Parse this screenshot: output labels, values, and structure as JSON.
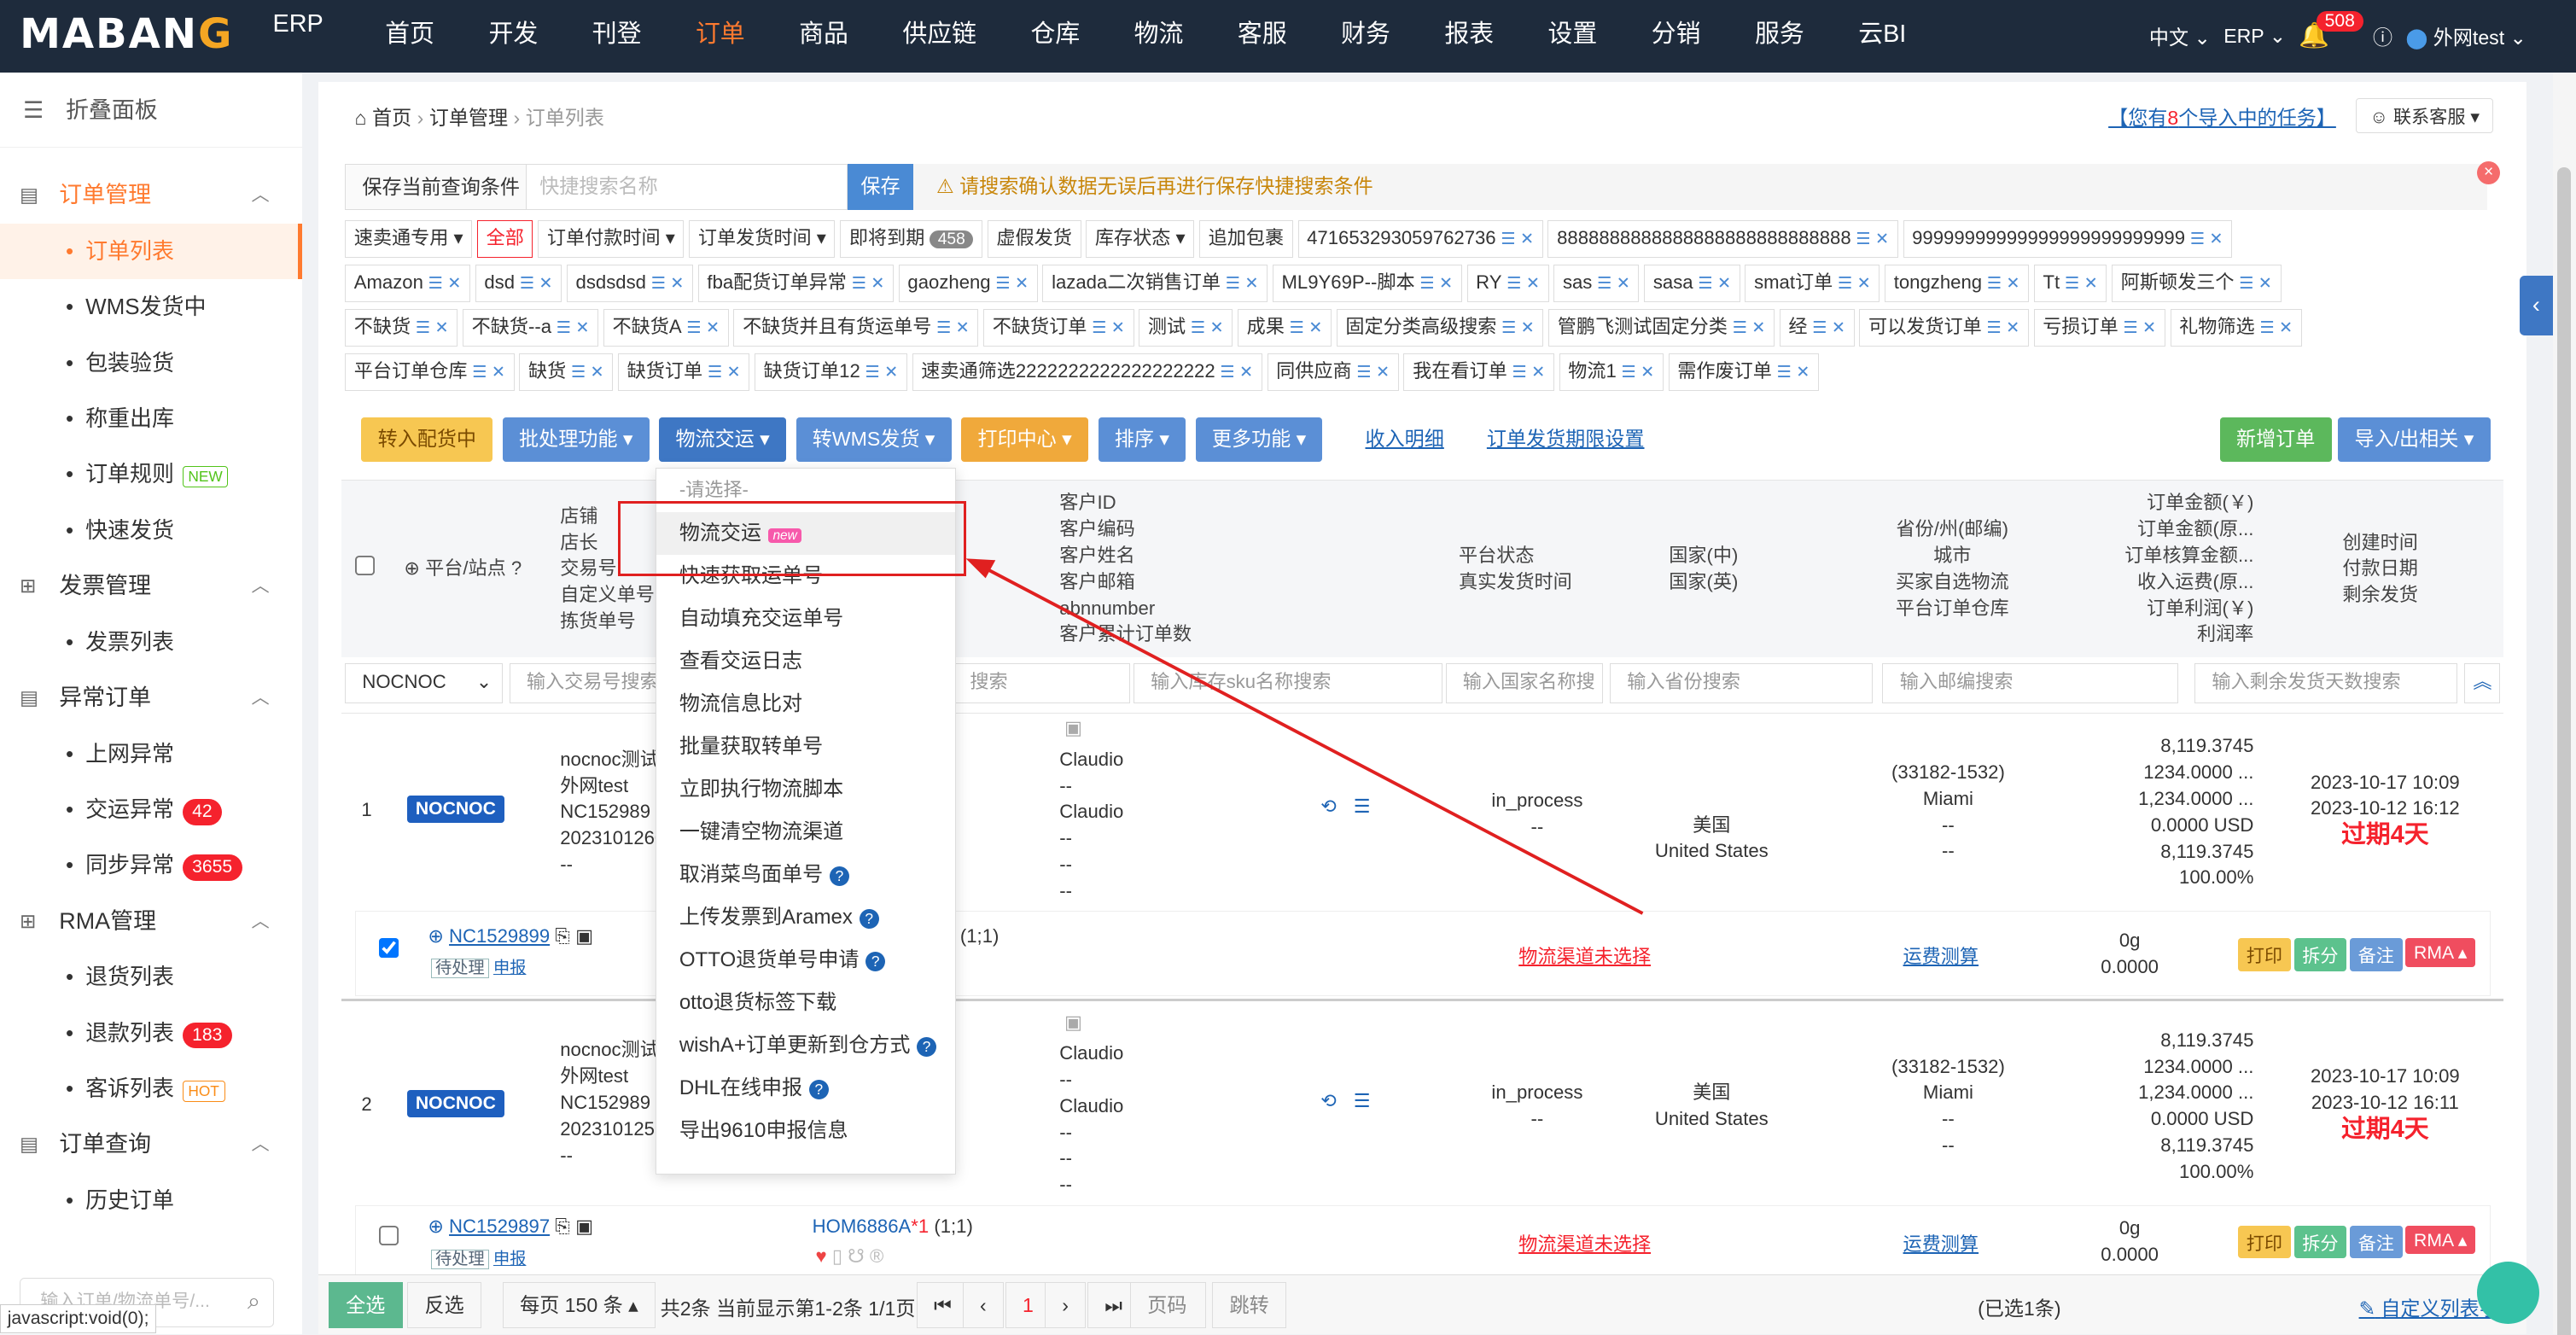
{
  "logo": {
    "text": "MABANG",
    "erp": "ERP"
  },
  "nav": [
    "首页",
    "开发",
    "刊登",
    "订单",
    "商品",
    "供应链",
    "仓库",
    "物流",
    "客服",
    "财务",
    "报表",
    "设置",
    "分销",
    "服务",
    "云BI"
  ],
  "top_right": {
    "lang": "中文",
    "erp": "ERP",
    "bell_count": "508",
    "user": "外网test"
  },
  "sidebar": {
    "fold": "折叠面板",
    "groups": [
      {
        "label": "订单管理",
        "items": [
          {
            "label": "订单列表"
          },
          {
            "label": "WMS发货中"
          },
          {
            "label": "包装验货"
          },
          {
            "label": "称重出库"
          },
          {
            "label": "订单规则",
            "tag": "NEW"
          },
          {
            "label": "快速发货"
          }
        ]
      },
      {
        "label": "发票管理",
        "items": [
          {
            "label": "发票列表"
          }
        ]
      },
      {
        "label": "异常订单",
        "items": [
          {
            "label": "上网异常"
          },
          {
            "label": "交运异常",
            "count": "42"
          },
          {
            "label": "同步异常",
            "count": "3655"
          }
        ]
      },
      {
        "label": "RMA管理",
        "items": [
          {
            "label": "退货列表"
          },
          {
            "label": "退款列表",
            "count": "183"
          },
          {
            "label": "客诉列表",
            "tag": "HOT"
          }
        ]
      },
      {
        "label": "订单查询",
        "items": [
          {
            "label": "历史订单"
          }
        ]
      }
    ],
    "search_placeholder": "输入订单/物流单号/..."
  },
  "status_bar": "javascript:void(0);",
  "breadcrumb": {
    "home": "首页",
    "section": "订单管理",
    "page": "订单列表"
  },
  "header_right": {
    "task_prefix": "【您有",
    "task_count": "8",
    "task_suffix": "个导入中的任务】",
    "support": "联系客服"
  },
  "save_bar": {
    "label": "保存当前查询条件",
    "placeholder": "快捷搜索名称",
    "button": "保存",
    "warning": "请搜索确认数据无误后再进行保存快捷搜索条件"
  },
  "filter_rows": [
    [
      "速卖通专用 ▾",
      "全部",
      "订单付款时间 ▾",
      "订单发货时间 ▾",
      "即将到期",
      "虚假发货",
      "库存状态 ▾",
      "追加包裹",
      "471653293059762736",
      "8888888888888888888888888888",
      "99999999999999999999999999"
    ],
    [
      "Amazon",
      "dsd",
      "dsdsdsd",
      "fba配货订单异常",
      "gaozheng",
      "lazada二次销售订单",
      "ML9Y69P--脚本",
      "RY",
      "sas",
      "sasa",
      "smat订单",
      "tongzheng",
      "Tt",
      "阿斯顿发三个"
    ],
    [
      "不缺货",
      "不缺货--a",
      "不缺货A",
      "不缺货并且有货运单号",
      "不缺货订单",
      "测试",
      "成果",
      "固定分类高级搜索",
      "管鹏飞测试固定分类",
      "经",
      "可以发货订单",
      "亏损订单",
      "礼物筛选"
    ],
    [
      "平台订单仓库",
      "缺货",
      "缺货订单",
      "缺货订单12",
      "速卖通筛选2222222222222222222",
      "同供应商",
      "我在看订单",
      "物流1",
      "需作废订单"
    ]
  ],
  "due_count": "458",
  "toolbar": {
    "b1": "转入配货中",
    "b2": "批处理功能 ▾",
    "b3": "物流交运 ▾",
    "b4": "转WMS发货 ▾",
    "b5": "打印中心 ▾",
    "b6": "排序 ▾",
    "b7": "更多功能 ▾",
    "l1": "收入明细",
    "l2": "订单发货期限设置",
    "r1": "新增订单",
    "r2": "导入/出相关 ▾"
  },
  "table_head": {
    "platform": "⊕ 平台/站点 ?",
    "shop": [
      "店铺",
      "店长",
      "交易号",
      "自定义单号",
      "拣货单号"
    ],
    "customer": [
      "客户ID",
      "客户编码",
      "客户姓名",
      "客户邮箱",
      "abnnumber",
      "客户累计订单数"
    ],
    "status": [
      "平台状态",
      "真实发货时间"
    ],
    "country": [
      "国家(中)",
      "国家(英)"
    ],
    "province": [
      "省份/州(邮编)",
      "城市",
      "买家自选物流",
      "平台订单仓库"
    ],
    "amount": [
      "订单金额(￥)",
      "订单金额(原...",
      "订单核算金额...",
      "收入运费(原...",
      "订单利润(￥)",
      "利润率"
    ],
    "time": [
      "创建时间",
      "付款日期",
      "剩余发货"
    ]
  },
  "filter_inputs": {
    "site": "NOCNOC",
    "trade": "输入交易号搜索",
    "search": "搜索",
    "sku": "输入库存sku名称搜索",
    "country": "输入国家名称搜",
    "province": "输入省份搜索",
    "zip": "输入邮编搜索",
    "remain": "输入剩余发货天数搜索"
  },
  "rows": [
    {
      "idx": "1",
      "platform": "NOCNOC",
      "shop": [
        "nocnoc测试",
        "外网test",
        "NC152989",
        "2023101260",
        "--"
      ],
      "customer": [
        "Claudio",
        "--",
        "Claudio",
        "--",
        "--",
        "--"
      ],
      "status": "in_process",
      "status2": "--",
      "country_cn": "美国",
      "country_en": "United States",
      "province": "(33182-1532)",
      "city": "Miami",
      "p3": "--",
      "p4": "--",
      "amounts": [
        "8,119.3745",
        "1234.0000 ...",
        "1,234.0000 ...",
        "0.0000 USD",
        "8,119.3745",
        "100.00%"
      ],
      "created": "2023-10-17 10:09",
      "paid": "2023-10-12 16:12",
      "expire": "过期4天",
      "order_no": "NC1529899",
      "state_tag": "待处理",
      "declare": "申报",
      "sku_qty": "(1;1)",
      "logistics": "物流渠道未选择",
      "fee": "运费测算",
      "weight": "0g",
      "wfee": "0.0000"
    },
    {
      "idx": "2",
      "platform": "NOCNOC",
      "shop": [
        "nocnoc测试",
        "外网test",
        "NC152989",
        "2023101255",
        "--"
      ],
      "customer": [
        "Claudio",
        "--",
        "Claudio",
        "--",
        "--",
        "--"
      ],
      "status": "in_process",
      "status2": "--",
      "country_cn": "美国",
      "country_en": "United States",
      "province": "(33182-1532)",
      "city": "Miami",
      "p3": "--",
      "p4": "--",
      "amounts": [
        "8,119.3745",
        "1234.0000 ...",
        "1,234.0000 ...",
        "0.0000 USD",
        "8,119.3745",
        "100.00%"
      ],
      "created": "2023-10-17 10:09",
      "paid": "2023-10-12 16:11",
      "expire": "过期4天",
      "order_no": "NC1529897",
      "state_tag": "待处理",
      "declare": "申报",
      "sku": "HOM6886A",
      "sku_mark": "*1",
      "sku_qty": "(1;1)",
      "logistics": "物流渠道未选择",
      "fee": "运费测算",
      "weight": "0g",
      "wfee": "0.0000"
    }
  ],
  "action_buttons": [
    "打印",
    "拆分",
    "备注",
    "RMA ▴"
  ],
  "dropdown": {
    "header": "-请选择-",
    "items": [
      "物流交运",
      "快速获取运单号",
      "自动填充交运单号",
      "查看交运日志",
      "物流信息比对",
      "批量获取转单号",
      "立即执行物流脚本",
      "一键清空物流渠道",
      "取消菜鸟面单号",
      "上传发票到Aramex",
      "OTTO退货单号申请",
      "otto退货标签下载",
      "wishA+订单更新到仓方式",
      "DHL在线申报",
      "导出9610申报信息"
    ],
    "new_tag": "new"
  },
  "bottom": {
    "select_all": "全选",
    "invert": "反选",
    "per_page": "每页 150 条 ▴",
    "summary": "共2条 当前显示第1-2条 1/1页",
    "page": "1",
    "page_label": "页码",
    "jump": "跳转",
    "selected": "(已选1条)",
    "custom_col": "自定义列表字段"
  },
  "colors": {
    "nav_bg": "#1e2b3c",
    "accent": "#ff7a2f",
    "link": "#1d64b5",
    "alert": "#f5222d"
  }
}
